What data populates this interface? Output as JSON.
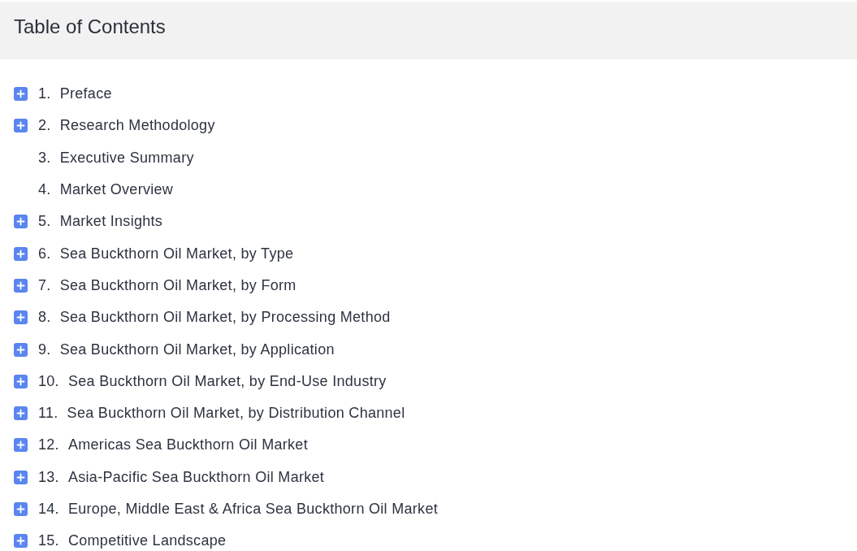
{
  "header": {
    "title": "Table of Contents"
  },
  "items": [
    {
      "number": "1.",
      "title": "Preface",
      "expandable": true
    },
    {
      "number": "2.",
      "title": "Research Methodology",
      "expandable": true
    },
    {
      "number": "3.",
      "title": "Executive Summary",
      "expandable": false
    },
    {
      "number": "4.",
      "title": "Market Overview",
      "expandable": false
    },
    {
      "number": "5.",
      "title": "Market Insights",
      "expandable": true
    },
    {
      "number": "6.",
      "title": "Sea Buckthorn Oil Market, by Type",
      "expandable": true
    },
    {
      "number": "7.",
      "title": "Sea Buckthorn Oil Market, by Form",
      "expandable": true
    },
    {
      "number": "8.",
      "title": "Sea Buckthorn Oil Market, by Processing Method",
      "expandable": true
    },
    {
      "number": "9.",
      "title": "Sea Buckthorn Oil Market, by Application",
      "expandable": true
    },
    {
      "number": "10.",
      "title": "Sea Buckthorn Oil Market, by End-Use Industry",
      "expandable": true
    },
    {
      "number": "11.",
      "title": "Sea Buckthorn Oil Market, by Distribution Channel",
      "expandable": true
    },
    {
      "number": "12.",
      "title": "Americas Sea Buckthorn Oil Market",
      "expandable": true
    },
    {
      "number": "13.",
      "title": "Asia-Pacific Sea Buckthorn Oil Market",
      "expandable": true
    },
    {
      "number": "14.",
      "title": "Europe, Middle East & Africa Sea Buckthorn Oil Market",
      "expandable": true
    },
    {
      "number": "15.",
      "title": "Competitive Landscape",
      "expandable": true
    }
  ]
}
